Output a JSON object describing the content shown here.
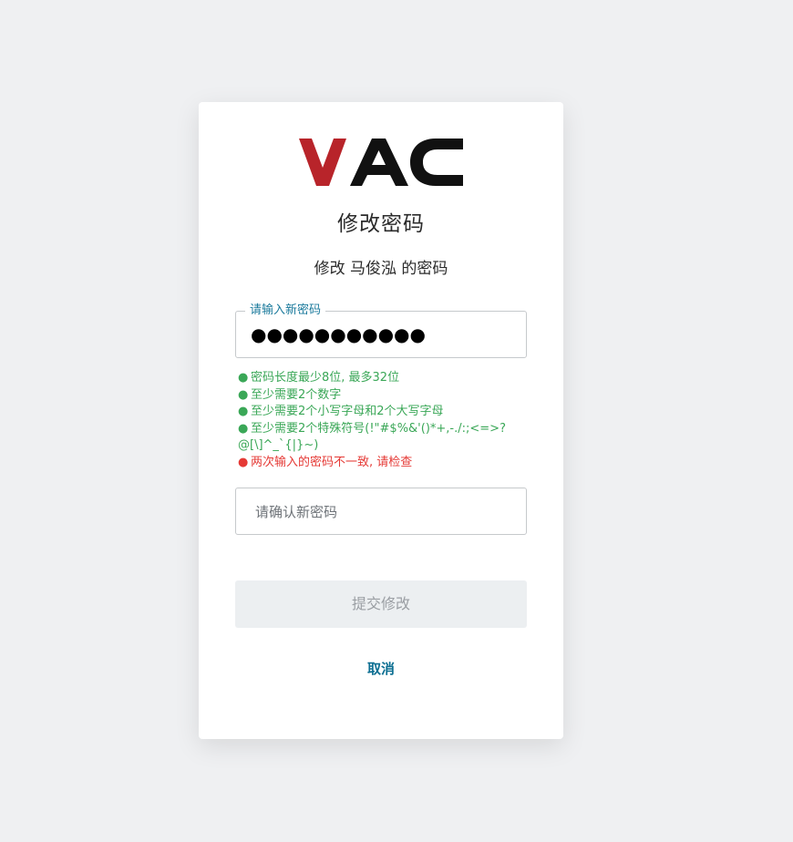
{
  "logo": {
    "text": "VAC",
    "colors": {
      "v": "#b8242a",
      "ac": "#111111"
    }
  },
  "title": "修改密码",
  "subtitle": "修改 马俊泓 的密码",
  "new_password": {
    "label": "请输入新密码",
    "value": "●●●●●●●●●●●"
  },
  "rules": [
    {
      "text": "密码长度最少8位, 最多32位",
      "status": "ok"
    },
    {
      "text": "至少需要2个数字",
      "status": "ok"
    },
    {
      "text": "至少需要2个小写字母和2个大写字母",
      "status": "ok"
    },
    {
      "text": "至少需要2个特殊符号(!\"#$%&'()*+,-./:;<=>?@[\\]^_`{|}~)",
      "status": "ok"
    },
    {
      "text": "两次输入的密码不一致, 请检查",
      "status": "error"
    }
  ],
  "confirm_password": {
    "placeholder": "请确认新密码"
  },
  "submit_label": "提交修改",
  "cancel_label": "取消",
  "colors": {
    "background": "#eff0f2",
    "accent": "#1b7a9c",
    "ok": "#3aa757",
    "error": "#e53935",
    "submit_bg": "#eceff1"
  }
}
